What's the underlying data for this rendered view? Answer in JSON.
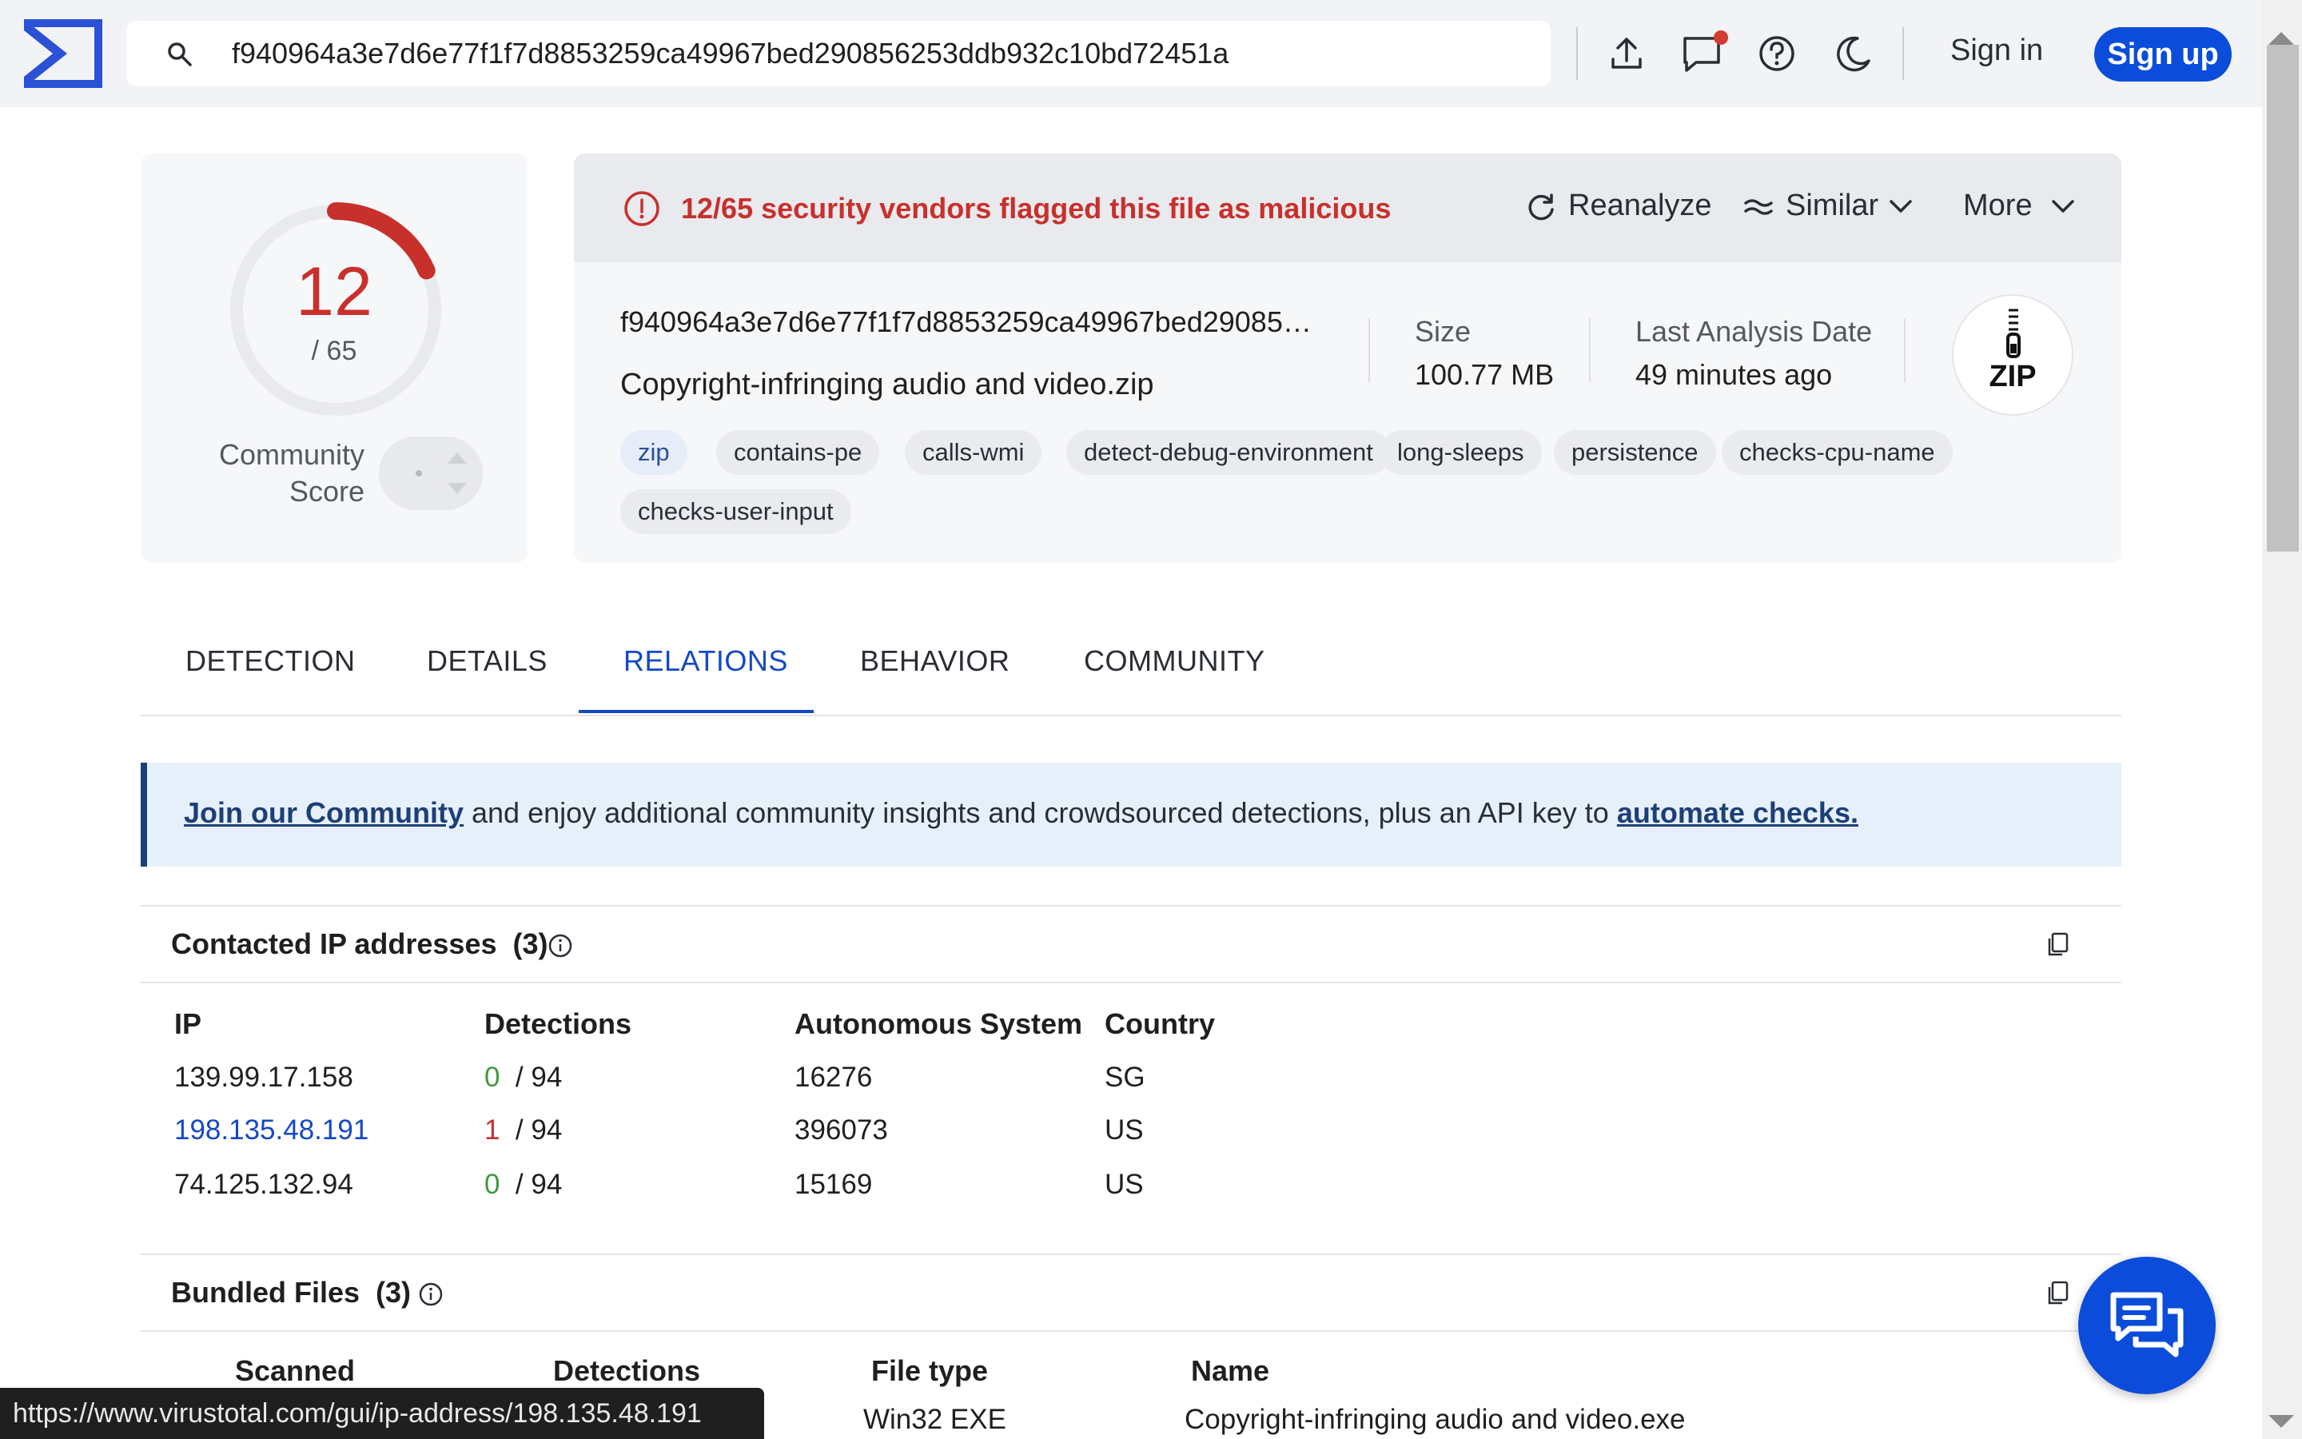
{
  "header": {
    "search_value": "f940964a3e7d6e77f1f7d8853259ca49967bed290856253ddb932c10bd72451a",
    "sign_in": "Sign in",
    "sign_up": "Sign up",
    "icons": [
      "upload-icon",
      "chat-notification-icon",
      "help-icon",
      "dark-mode-icon"
    ]
  },
  "score": {
    "detected": "12",
    "total": "/ 65",
    "community_label_1": "Community",
    "community_label_2": "Score",
    "detected_ratio": 0.1846,
    "accent": "#c8302c"
  },
  "summary": {
    "alert": "12/65 security vendors flagged this file as malicious",
    "actions": {
      "reanalyze": "Reanalyze",
      "similar": "Similar",
      "more": "More"
    },
    "hash": "f940964a3e7d6e77f1f7d8853259ca49967bed2908562…",
    "file_name": "Copyright-infringing audio and video.zip",
    "size_label": "Size",
    "size_value": "100.77 MB",
    "date_label": "Last Analysis Date",
    "date_value": "49 minutes ago",
    "file_type_badge": "ZIP",
    "tags": [
      "zip",
      "contains-pe",
      "calls-wmi",
      "detect-debug-environment",
      "long-sleeps",
      "persistence",
      "checks-cpu-name",
      "checks-user-input"
    ]
  },
  "tabs": [
    "DETECTION",
    "DETAILS",
    "RELATIONS",
    "BEHAVIOR",
    "COMMUNITY"
  ],
  "active_tab": "RELATIONS",
  "banner": {
    "link1": "Join our Community",
    "middle": " and enjoy additional community insights and crowdsourced detections, plus an API key to ",
    "link2": "automate checks."
  },
  "contacted_ips": {
    "title": "Contacted IP addresses",
    "count": "(3)",
    "headers": [
      "IP",
      "Detections",
      "Autonomous System",
      "Country"
    ],
    "rows": [
      {
        "ip": "139.99.17.158",
        "det": "0",
        "total": "/ 94",
        "asn": "16276",
        "country": "SG"
      },
      {
        "ip": "198.135.48.191",
        "det": "1",
        "total": "/ 94",
        "asn": "396073",
        "country": "US"
      },
      {
        "ip": "74.125.132.94",
        "det": "0",
        "total": "/ 94",
        "asn": "15169",
        "country": "US"
      }
    ]
  },
  "bundled_files": {
    "title": "Bundled Files",
    "count": "(3)",
    "headers": [
      "Scanned",
      "Detections",
      "File type",
      "Name"
    ],
    "row_partial": {
      "file_type": "Win32 EXE",
      "name": "Copyright-infringing audio and video.exe"
    }
  },
  "status_url": "https://www.virustotal.com/gui/ip-address/198.135.48.191"
}
